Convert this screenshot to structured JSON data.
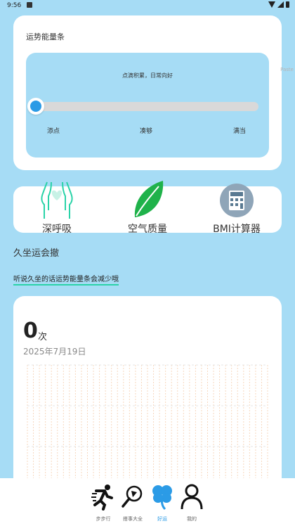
{
  "status": {
    "time": "9:56"
  },
  "energy": {
    "title": "运势能量条",
    "message": "点滴积累，日常向好",
    "labels": [
      "添点",
      "凑够",
      "满当"
    ],
    "level": 0,
    "side_tag": "Paste"
  },
  "features": [
    {
      "label": "深呼吸",
      "icon": "lungs-icon"
    },
    {
      "label": "空气质量",
      "icon": "leaf-icon"
    },
    {
      "label": "BMI计算器",
      "icon": "calculator-icon"
    }
  ],
  "sedentary": {
    "title": "久坐运会撤",
    "note": "听说久坐的话运势能量条会减少哦"
  },
  "count": {
    "value": "0",
    "unit": "次",
    "date": "2025年7月19日"
  },
  "chart_data": {
    "type": "bar",
    "categories": [],
    "values": [],
    "grid": true
  },
  "nav": [
    {
      "label": "步步行",
      "icon": "runner-icon",
      "active": false
    },
    {
      "label": "搭事大全",
      "icon": "magnifier-icon",
      "active": false
    },
    {
      "label": "好运",
      "icon": "clover-icon",
      "active": true
    },
    {
      "label": "我的",
      "icon": "person-icon",
      "active": false
    }
  ],
  "colors": {
    "background": "#a6dcf5",
    "accent": "#2b9be6",
    "leaf": "#1fb24a",
    "highlight": "#2ad3a8"
  }
}
